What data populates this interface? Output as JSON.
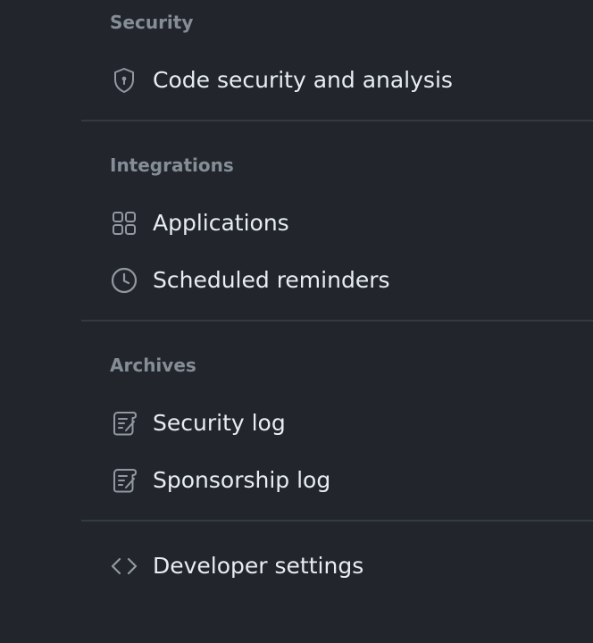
{
  "sections": {
    "security": {
      "heading": "Security",
      "items": [
        {
          "label": "Code security and analysis",
          "icon": "shield-lock-icon"
        }
      ]
    },
    "integrations": {
      "heading": "Integrations",
      "items": [
        {
          "label": "Applications",
          "icon": "apps-icon"
        },
        {
          "label": "Scheduled reminders",
          "icon": "clock-icon"
        }
      ]
    },
    "archives": {
      "heading": "Archives",
      "items": [
        {
          "label": "Security log",
          "icon": "log-icon"
        },
        {
          "label": "Sponsorship log",
          "icon": "log-icon"
        }
      ]
    },
    "developer": {
      "items": [
        {
          "label": "Developer settings",
          "icon": "code-icon"
        }
      ]
    }
  },
  "colors": {
    "background": "#22262c",
    "heading": "#858d97",
    "text": "#e6edf3",
    "icon": "#9198a1",
    "divider": "#333a43"
  }
}
